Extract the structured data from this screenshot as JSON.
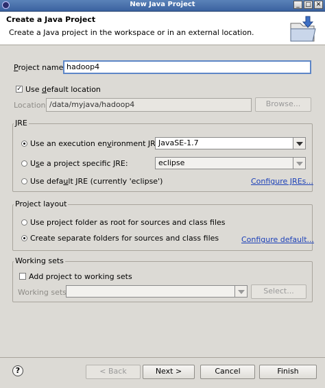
{
  "window": {
    "title": "New Java Project"
  },
  "header": {
    "title": "Create a Java Project",
    "description": "Create a Java project in the workspace or in an external location."
  },
  "project_name": {
    "label": "Project name:",
    "value": "hadoop4"
  },
  "default_location": {
    "label_pre": "Use ",
    "label_u": "d",
    "label_post": "efault location",
    "checked": true
  },
  "location": {
    "label": "Location:",
    "value": "/data/myjava/hadoop4",
    "browse_label": "Browse..."
  },
  "jre": {
    "title": "JRE",
    "option1": {
      "label_pre": "Use an execution en",
      "label_u": "v",
      "label_post": "ironment JRE:",
      "value": "JavaSE-1.7",
      "selected": true
    },
    "option2": {
      "label_pre": "U",
      "label_u": "s",
      "label_post": "e a project specific JRE:",
      "value": "eclipse",
      "selected": false
    },
    "option3": {
      "label_pre": "Use defa",
      "label_u": "u",
      "label_post": "lt JRE (currently 'eclipse')",
      "selected": false
    },
    "configure_link": "Configure JREs..."
  },
  "layout": {
    "title": "Project layout",
    "option1": {
      "label": "Use project folder as root for sources and class files",
      "selected": false
    },
    "option2": {
      "label": "Create separate folders for sources and class files",
      "selected": true
    },
    "configure_link": "Configure default..."
  },
  "working_sets": {
    "title": "Working sets",
    "add_label": "Add project to working sets",
    "add_checked": false,
    "field_label": "Working sets:",
    "value": "",
    "select_label": "Select..."
  },
  "footer": {
    "back_label": "< Back",
    "next_label": "Next >",
    "cancel_label": "Cancel",
    "finish_label": "Finish",
    "help_glyph": "?"
  }
}
